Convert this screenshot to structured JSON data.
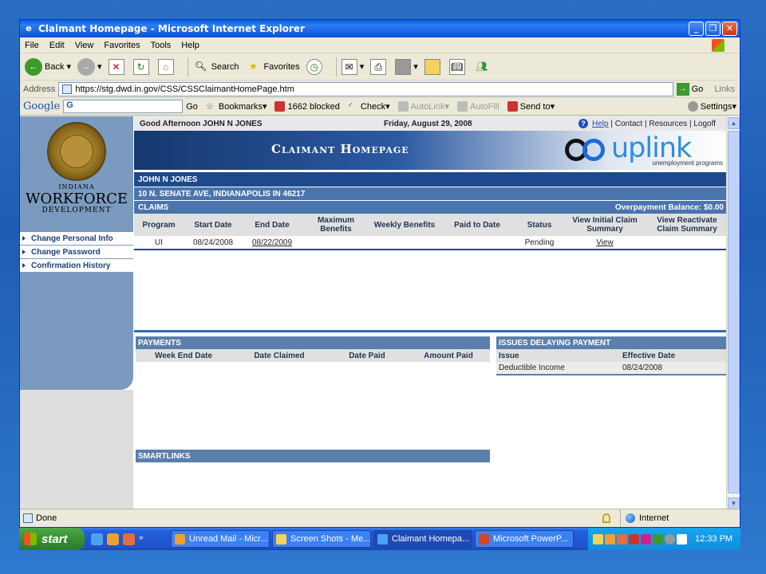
{
  "window": {
    "title": "Claimant Homepage - Microsoft Internet Explorer"
  },
  "menu": [
    "File",
    "Edit",
    "View",
    "Favorites",
    "Tools",
    "Help"
  ],
  "toolbar": {
    "back": "Back",
    "search": "Search",
    "favorites": "Favorites"
  },
  "address": {
    "label": "Address",
    "url": "https://stg.dwd.in.gov/CSS/CSSClaimantHomePage.htm",
    "go": "Go",
    "links": "Links"
  },
  "googlebar": {
    "logo": "Google",
    "search_value": "G",
    "go": "Go",
    "bookmarks": "Bookmarks",
    "blocked": "1662 blocked",
    "check": "Check",
    "autolink": "AutoLink",
    "autofill": "AutoFill",
    "sendto": "Send to",
    "settings": "Settings"
  },
  "page": {
    "greeting": "Good Afternoon JOHN N JONES",
    "date": "Friday, August 29, 2008",
    "links": {
      "help": "Help",
      "contact": "Contact",
      "resources": "Resources",
      "logoff": "Logoff"
    },
    "banner_title": "Claimant Homepage",
    "brand": {
      "word": "uplink",
      "sub": "unemployment programs"
    },
    "agency": {
      "line1": "INDIANA",
      "line2": "WORKFORCE",
      "line3": "DEVELOPMENT"
    },
    "nav": [
      "Change Personal Info",
      "Change Password",
      "Confirmation History"
    ],
    "name": "JOHN N JONES",
    "address": "10 N. SENATE AVE, INDIANAPOLIS IN 46217",
    "claims": {
      "title": "CLAIMS",
      "overpayment": "Overpayment Balance: $0.00",
      "headers": [
        "Program",
        "Start Date",
        "End Date",
        "Maximum Benefits",
        "Weekly Benefits",
        "Paid to Date",
        "Status",
        "View Initial Claim Summary",
        "View Reactivate Claim Summary"
      ],
      "row": {
        "program": "UI",
        "start": "08/24/2008",
        "end": "08/22/2009",
        "max": "",
        "weekly": "",
        "paid": "",
        "status": "Pending",
        "view": "View",
        "reactivate": ""
      }
    },
    "payments": {
      "title": "PAYMENTS",
      "headers": [
        "Week End Date",
        "Date Claimed",
        "Date Paid",
        "Amount Paid"
      ]
    },
    "issues": {
      "title": "ISSUES DELAYING PAYMENT",
      "headers": [
        "Issue",
        "Effective Date"
      ],
      "row": {
        "issue": "Deductible Income",
        "date": "08/24/2008"
      }
    },
    "smartlinks": {
      "title": "SMARTLINKS"
    }
  },
  "status": {
    "text": "Done",
    "zone": "Internet"
  },
  "taskbar": {
    "start": "start",
    "tasks": [
      "Unread Mail - Micr...",
      "Screen Shots - Me...",
      "Claimant Homepa...",
      "Microsoft PowerP..."
    ],
    "clock": "12:33 PM"
  }
}
